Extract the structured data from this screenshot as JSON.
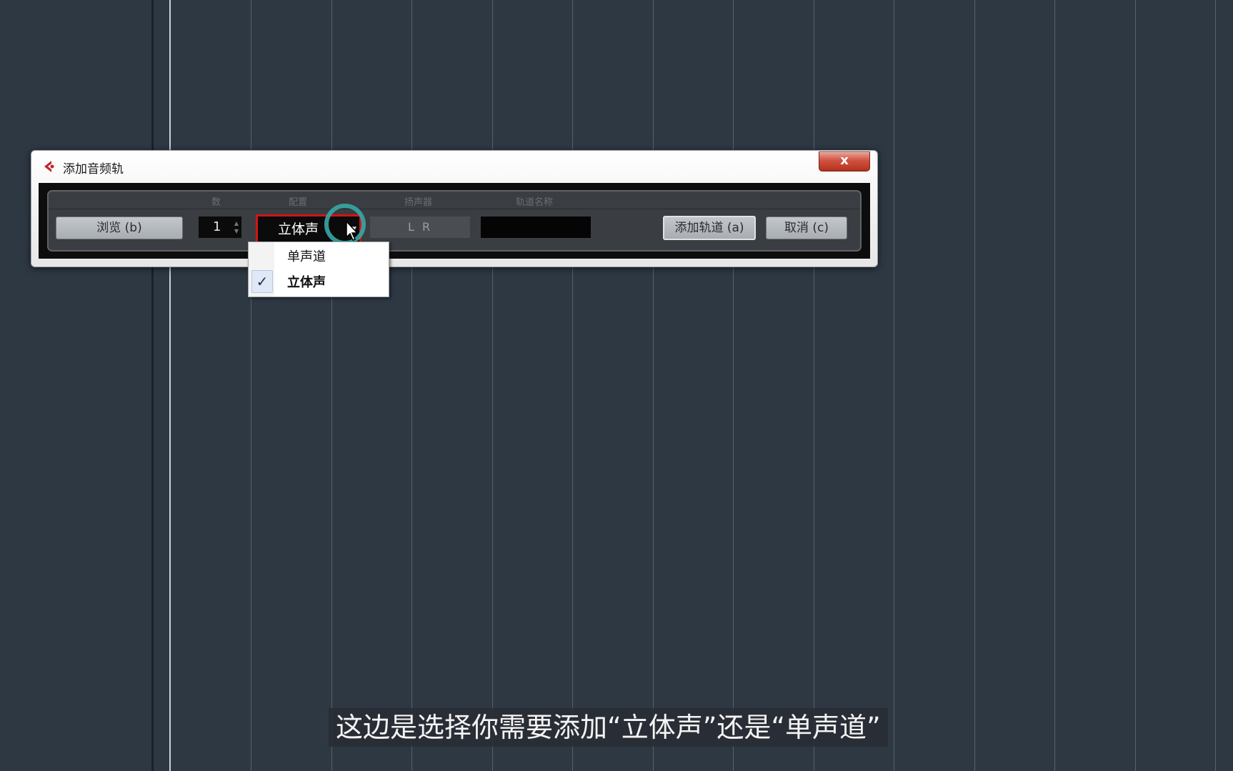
{
  "dialog": {
    "title": "添加音频轨",
    "close_label": "x"
  },
  "columns": {
    "count": "数",
    "config": "配置",
    "speaker": "扬声器",
    "track_name": "轨道名称"
  },
  "controls": {
    "browse_label": "浏览 (b)",
    "count_value": "1",
    "config_value": "立体声",
    "speaker_value": "L R",
    "track_name_value": "",
    "add_track_label": "添加轨道 (a)",
    "cancel_label": "取消 (c)"
  },
  "dropdown": {
    "items": [
      {
        "label": "单声道",
        "selected": false
      },
      {
        "label": "立体声",
        "selected": true
      }
    ],
    "check_mark": "✓"
  },
  "subtitle": "这边是选择你需要添加“立体声”还是“单声道”",
  "colors": {
    "background": "#2e3843",
    "highlight_border": "#d01515",
    "cursor_halo": "#39a6a6"
  }
}
